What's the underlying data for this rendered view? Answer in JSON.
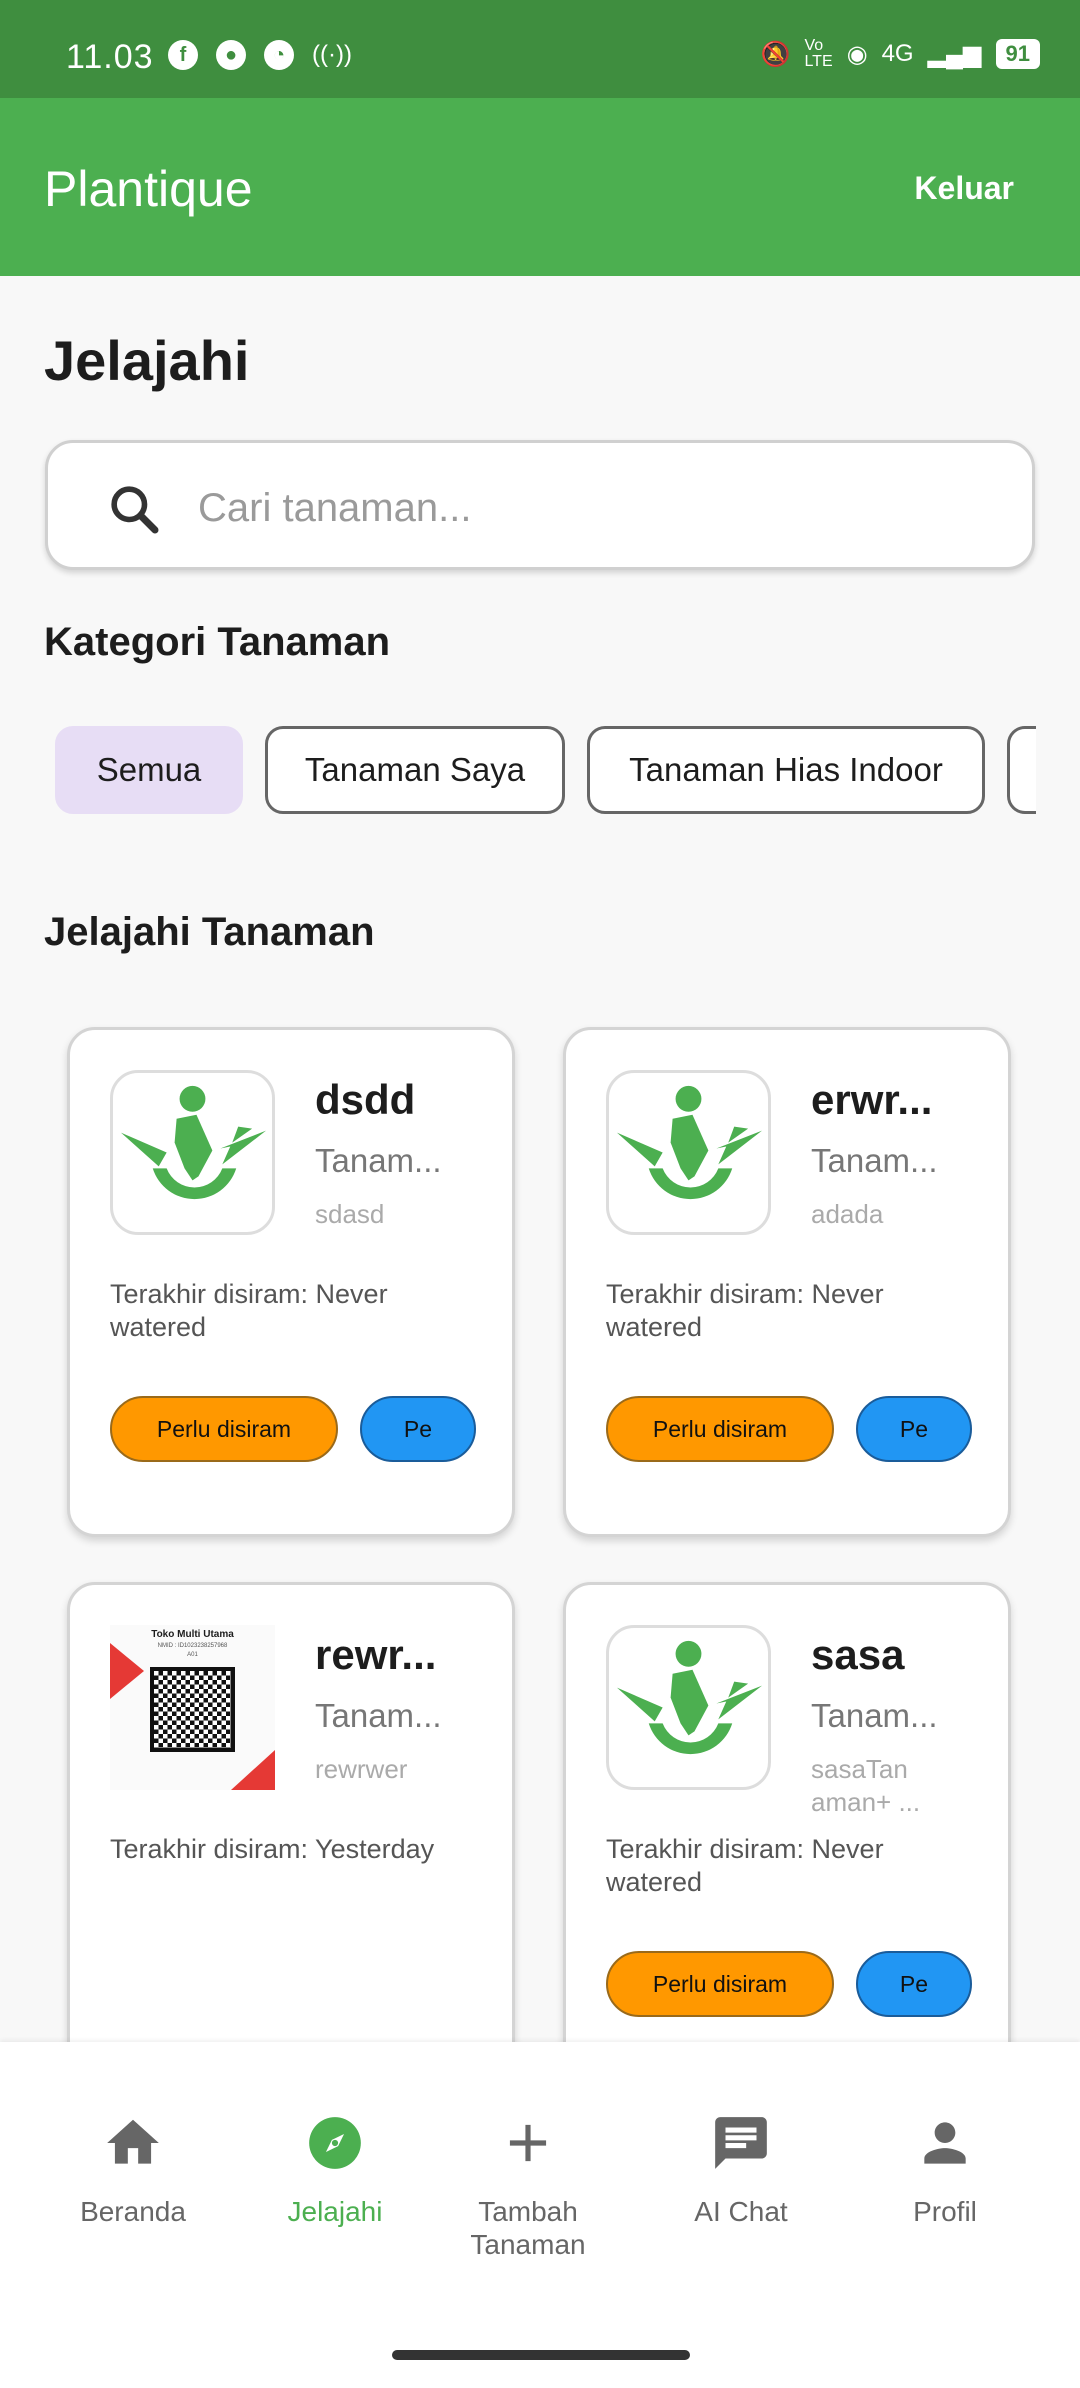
{
  "status_bar": {
    "time": "11.03",
    "network": "4G",
    "battery": "91"
  },
  "app_bar": {
    "title": "Plantique",
    "logout_label": "Keluar"
  },
  "page": {
    "title": "Jelajahi"
  },
  "search": {
    "placeholder": "Cari tanaman...",
    "value": ""
  },
  "categories": {
    "heading": "Kategori Tanaman",
    "chips": [
      {
        "label": "Semua",
        "selected": true
      },
      {
        "label": "Tanaman Saya",
        "selected": false
      },
      {
        "label": "Tanaman Hias Indoor",
        "selected": false
      }
    ]
  },
  "explore": {
    "heading": "Jelajahi Tanaman",
    "cards": [
      {
        "name": "dsdd",
        "category": "Tanam...",
        "description": "sdasd",
        "last_watered": "Terakhir disiram: Never watered",
        "water_label": "Perlu disiram",
        "action_label": "Pe",
        "image": "plantique-logo"
      },
      {
        "name": "erwr...",
        "category": "Tanam...",
        "description": "adada",
        "last_watered": "Terakhir disiram: Never watered",
        "water_label": "Perlu disiram",
        "action_label": "Pe",
        "image": "plantique-logo"
      },
      {
        "name": "rewr...",
        "category": "Tanam...",
        "description": "rewrwer",
        "last_watered": "Terakhir disiram: Yesterday",
        "image": "qr-code-photo",
        "qr_title": "Toko Multi Utama",
        "qr_sub": "NMID : ID1023238257968",
        "qr_code": "A01"
      },
      {
        "name": "sasa",
        "category": "Tanam...",
        "description": "sasaTan aman+ ...",
        "last_watered": "Terakhir disiram: Never watered",
        "water_label": "Perlu disiram",
        "action_label": "Pe",
        "image": "plantique-logo"
      }
    ]
  },
  "bottom_nav": {
    "items": [
      {
        "label": "Beranda",
        "icon": "home-icon",
        "active": false
      },
      {
        "label": "Jelajahi",
        "icon": "compass-icon",
        "active": true
      },
      {
        "label": "Tambah Tanaman",
        "icon": "plus-icon",
        "active": false
      },
      {
        "label": "AI Chat",
        "icon": "chat-icon",
        "active": false
      },
      {
        "label": "Profil",
        "icon": "person-icon",
        "active": false
      }
    ]
  },
  "colors": {
    "primary": "#4caf50",
    "status_bar": "#3f8e3f",
    "water_button": "#ff9800",
    "action_button": "#2196f3",
    "chip_selected": "#e7ddf5"
  }
}
